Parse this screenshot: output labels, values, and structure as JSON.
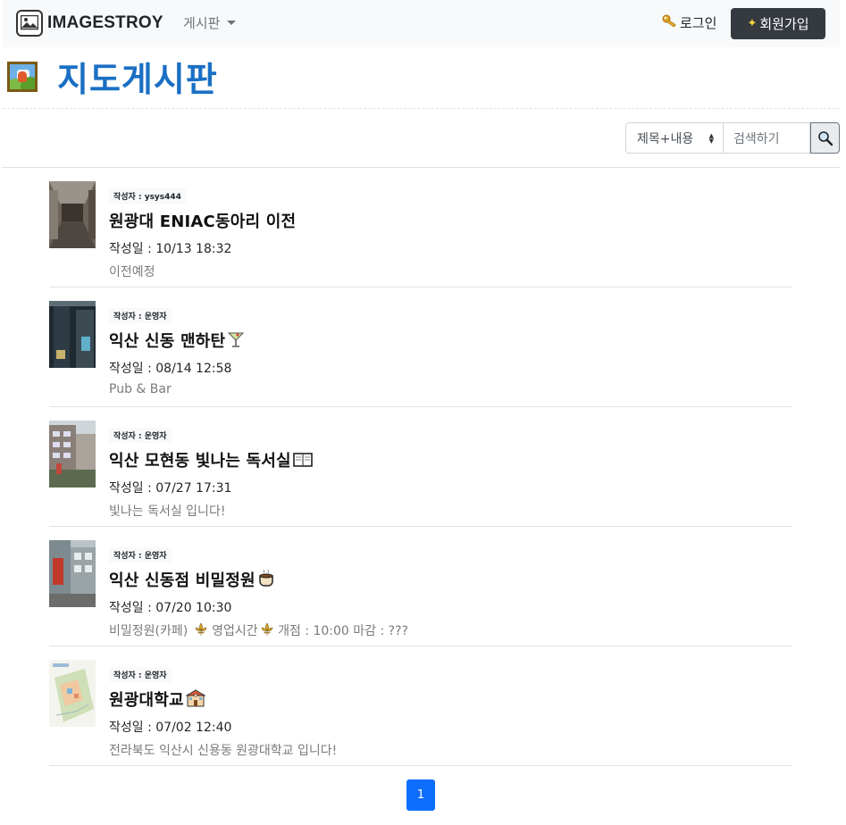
{
  "navbar": {
    "brand": "IMAGESTROY",
    "menu_label": "게시판",
    "login_label": "로그인",
    "signup_label": "회원가입"
  },
  "page": {
    "title": "지도게시판"
  },
  "search": {
    "select_value": "제목+내용",
    "input_placeholder": "검색하기"
  },
  "posts": [
    {
      "author": "작성자 : ysys444",
      "title": "원광대 ENIAC동아리 이전",
      "date": "작성일 : 10/13 18:32",
      "description": "이전예정"
    },
    {
      "author": "작성자 : 운영자",
      "title": "익산 신동 맨하탄",
      "date": "작성일 : 08/14 12:58",
      "description": "Pub & Bar"
    },
    {
      "author": "작성자 : 운영자",
      "title": "익산 모현동 빛나는 독서실",
      "date": "작성일 : 07/27 17:31",
      "description": "빛나는 독서실 입니다!"
    },
    {
      "author": "작성자 : 운영자",
      "title": "익산 신동점 비밀정원",
      "date": "작성일 : 07/20 10:30",
      "description_parts": [
        "비밀정원(카페) ",
        " 영업시간",
        " 개점 : 10:00 마감 : ???"
      ]
    },
    {
      "author": "작성자 : 운영자",
      "title": "원광대학교",
      "date": "작성일 : 07/02 12:40",
      "description": "전라북도 익산시 신용동 원광대학교 입니다!"
    }
  ],
  "pagination": {
    "current": "1"
  }
}
